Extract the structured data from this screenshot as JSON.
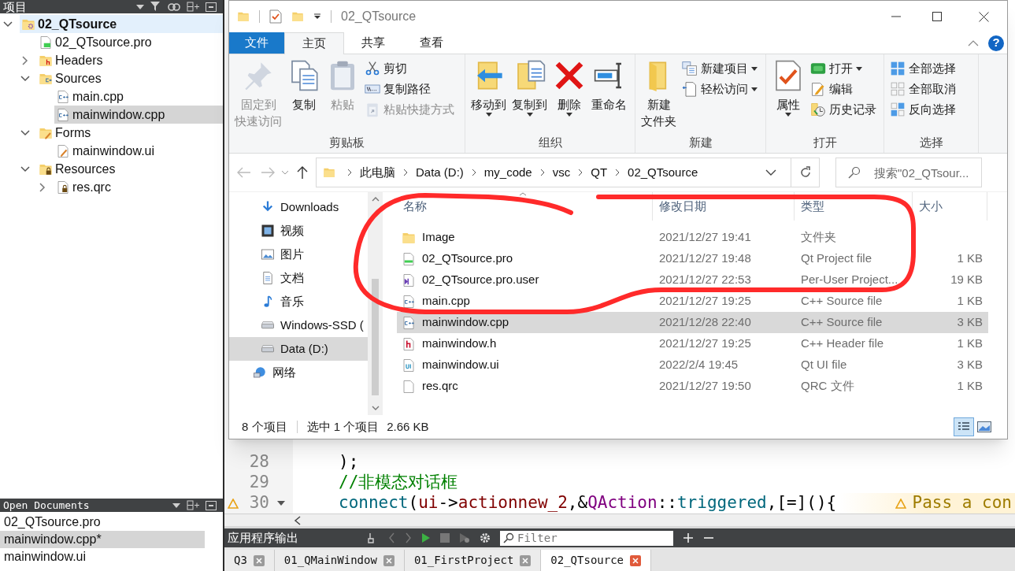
{
  "project_panel": {
    "title": "项目",
    "tree": [
      {
        "label": "02_QTsource",
        "kind": "project",
        "selected": false,
        "expanded": true,
        "children": [
          {
            "label": "02_QTsource.pro",
            "kind": "pro",
            "selected": false
          },
          {
            "label": "Headers",
            "kind": "headers",
            "selected": false,
            "expanded": false
          },
          {
            "label": "Sources",
            "kind": "sources",
            "selected": false,
            "expanded": true,
            "children": [
              {
                "label": "main.cpp",
                "kind": "cpp",
                "selected": false
              },
              {
                "label": "mainwindow.cpp",
                "kind": "cpp",
                "selected": true
              }
            ]
          },
          {
            "label": "Forms",
            "kind": "forms",
            "selected": false,
            "expanded": true,
            "children": [
              {
                "label": "mainwindow.ui",
                "kind": "ui",
                "selected": false
              }
            ]
          },
          {
            "label": "Resources",
            "kind": "resources",
            "selected": false,
            "expanded": true,
            "children": [
              {
                "label": "res.qrc",
                "kind": "qrc",
                "selected": false,
                "expanded": false
              }
            ]
          }
        ]
      }
    ]
  },
  "open_documents": {
    "title": "Open Documents",
    "items": [
      {
        "label": "02_QTsource.pro",
        "selected": false
      },
      {
        "label": "mainwindow.cpp*",
        "selected": true
      },
      {
        "label": "mainwindow.ui",
        "selected": false
      }
    ]
  },
  "editor": {
    "lines": [
      {
        "number": "28",
        "warning": false,
        "fold": false,
        "tokens": [
          {
            "text": ");",
            "kind": "plain"
          }
        ]
      },
      {
        "number": "29",
        "warning": false,
        "fold": false,
        "tokens": [
          {
            "text": "//非模态对话框",
            "kind": "comment"
          }
        ]
      },
      {
        "number": "30",
        "warning": true,
        "fold": true,
        "annotation": "Pass a con",
        "tokens": [
          {
            "text": "connect",
            "kind": "function"
          },
          {
            "text": "(",
            "kind": "plain"
          },
          {
            "text": "ui",
            "kind": "member"
          },
          {
            "text": "->",
            "kind": "plain"
          },
          {
            "text": "actionnew_2",
            "kind": "member"
          },
          {
            "text": ",&",
            "kind": "plain"
          },
          {
            "text": "QAction",
            "kind": "type"
          },
          {
            "text": "::",
            "kind": "plain"
          },
          {
            "text": "triggered",
            "kind": "function"
          },
          {
            "text": ",[=](){",
            "kind": "plain"
          }
        ]
      }
    ]
  },
  "output_pane": {
    "title": "应用程序输出",
    "filter_placeholder": "Filter"
  },
  "tabs": [
    {
      "label": "Q3",
      "selected": false
    },
    {
      "label": "01_QMainWindow",
      "selected": false
    },
    {
      "label": "01_FirstProject",
      "selected": false
    },
    {
      "label": "02_QTsource",
      "selected": true
    }
  ],
  "explorer": {
    "title": "02_QTsource",
    "help_button": "?",
    "ribbon_tabs": [
      {
        "label": "文件",
        "kind": "file",
        "selected": false
      },
      {
        "label": "主页",
        "kind": "tab",
        "selected": true
      },
      {
        "label": "共享",
        "kind": "tab",
        "selected": false
      },
      {
        "label": "查看",
        "kind": "tab",
        "selected": false
      }
    ],
    "groups": [
      {
        "label": "剪贴板",
        "items": [
          {
            "lines": [
              "固定到",
              "快速访问"
            ],
            "kind": "large",
            "disabled": true,
            "dropdown": false
          },
          {
            "lines": [
              "复制"
            ],
            "kind": "large",
            "disabled": false,
            "dropdown": false
          },
          {
            "lines": [
              "粘贴"
            ],
            "kind": "large",
            "disabled": true,
            "dropdown": false
          },
          {
            "label": "剪切",
            "kind": "small",
            "disabled": false,
            "dropdown": false
          },
          {
            "label": "复制路径",
            "kind": "small",
            "disabled": false,
            "dropdown": false
          },
          {
            "label": "粘贴快捷方式",
            "kind": "small",
            "disabled": true,
            "dropdown": false
          }
        ]
      },
      {
        "label": "组织",
        "items": [
          {
            "lines": [
              "移动到"
            ],
            "kind": "large",
            "disabled": false,
            "dropdown": true
          },
          {
            "lines": [
              "复制到"
            ],
            "kind": "large",
            "disabled": false,
            "dropdown": true
          },
          {
            "lines": [
              "删除"
            ],
            "kind": "large",
            "disabled": false,
            "dropdown": true
          },
          {
            "lines": [
              "重命名"
            ],
            "kind": "large",
            "disabled": false,
            "dropdown": false
          }
        ]
      },
      {
        "label": "新建",
        "items": [
          {
            "lines": [
              "新建",
              "文件夹"
            ],
            "kind": "large",
            "disabled": false,
            "dropdown": false
          },
          {
            "label": "新建项目",
            "kind": "small",
            "disabled": false,
            "dropdown": true
          },
          {
            "label": "轻松访问",
            "kind": "small",
            "disabled": false,
            "dropdown": true
          }
        ]
      },
      {
        "label": "打开",
        "items": [
          {
            "lines": [
              "属性"
            ],
            "kind": "large",
            "disabled": false,
            "dropdown": true
          },
          {
            "label": "打开",
            "kind": "small",
            "disabled": false,
            "dropdown": true
          },
          {
            "label": "编辑",
            "kind": "small",
            "disabled": false,
            "dropdown": false
          },
          {
            "label": "历史记录",
            "kind": "small",
            "disabled": false,
            "dropdown": false
          }
        ]
      },
      {
        "label": "选择",
        "items": [
          {
            "label": "全部选择",
            "kind": "small",
            "disabled": false,
            "dropdown": false
          },
          {
            "label": "全部取消",
            "kind": "small",
            "disabled": false,
            "dropdown": false
          },
          {
            "label": "反向选择",
            "kind": "small",
            "disabled": false,
            "dropdown": false
          }
        ]
      }
    ],
    "breadcrumbs": [
      "此电脑",
      "Data (D:)",
      "my_code",
      "vsc",
      "QT",
      "02_QTsource"
    ],
    "search_placeholder": "搜索\"02_QTsour...",
    "nav_items": [
      {
        "label": "Downloads",
        "kind": "downloads",
        "selected": false
      },
      {
        "label": "视频",
        "kind": "videos",
        "selected": false
      },
      {
        "label": "图片",
        "kind": "pictures",
        "selected": false
      },
      {
        "label": "文档",
        "kind": "documents",
        "selected": false
      },
      {
        "label": "音乐",
        "kind": "music",
        "selected": false
      },
      {
        "label": "Windows-SSD (",
        "kind": "drive",
        "selected": false
      },
      {
        "label": "Data (D:)",
        "kind": "drive",
        "selected": true
      },
      {
        "label": "网络",
        "kind": "network",
        "selected": false
      }
    ],
    "columns": [
      "名称",
      "修改日期",
      "类型",
      "大小"
    ],
    "files": [
      {
        "name": "Image",
        "kind": "folder",
        "date": "2021/12/27 19:41",
        "type": "文件夹",
        "selected": false
      },
      {
        "name": "02_QTsource.pro",
        "kind": "pro",
        "date": "2021/12/27 19:48",
        "type": "Qt Project file",
        "size": "1 KB",
        "selected": false
      },
      {
        "name": "02_QTsource.pro.user",
        "kind": "user",
        "date": "2021/12/27 22:53",
        "type": "Per-User Project...",
        "size": "19 KB",
        "selected": false
      },
      {
        "name": "main.cpp",
        "kind": "cpp",
        "date": "2021/12/27 19:25",
        "type": "C++ Source file",
        "size": "1 KB",
        "selected": false
      },
      {
        "name": "mainwindow.cpp",
        "kind": "cpp",
        "date": "2021/12/28 22:40",
        "type": "C++ Source file",
        "size": "3 KB",
        "selected": true
      },
      {
        "name": "mainwindow.h",
        "kind": "h",
        "date": "2021/12/27 19:25",
        "type": "C++ Header file",
        "size": "1 KB",
        "selected": false
      },
      {
        "name": "mainwindow.ui",
        "kind": "ui",
        "date": "2022/2/4 19:45",
        "type": "Qt UI file",
        "size": "3 KB",
        "selected": false
      },
      {
        "name": "res.qrc",
        "kind": "qrc",
        "date": "2021/12/27 19:50",
        "type": "QRC 文件",
        "size": "1 KB",
        "selected": false
      }
    ],
    "status": {
      "count": "8 个项目",
      "selection": "选中 1 个项目",
      "selection_size": "2.66 KB"
    }
  }
}
